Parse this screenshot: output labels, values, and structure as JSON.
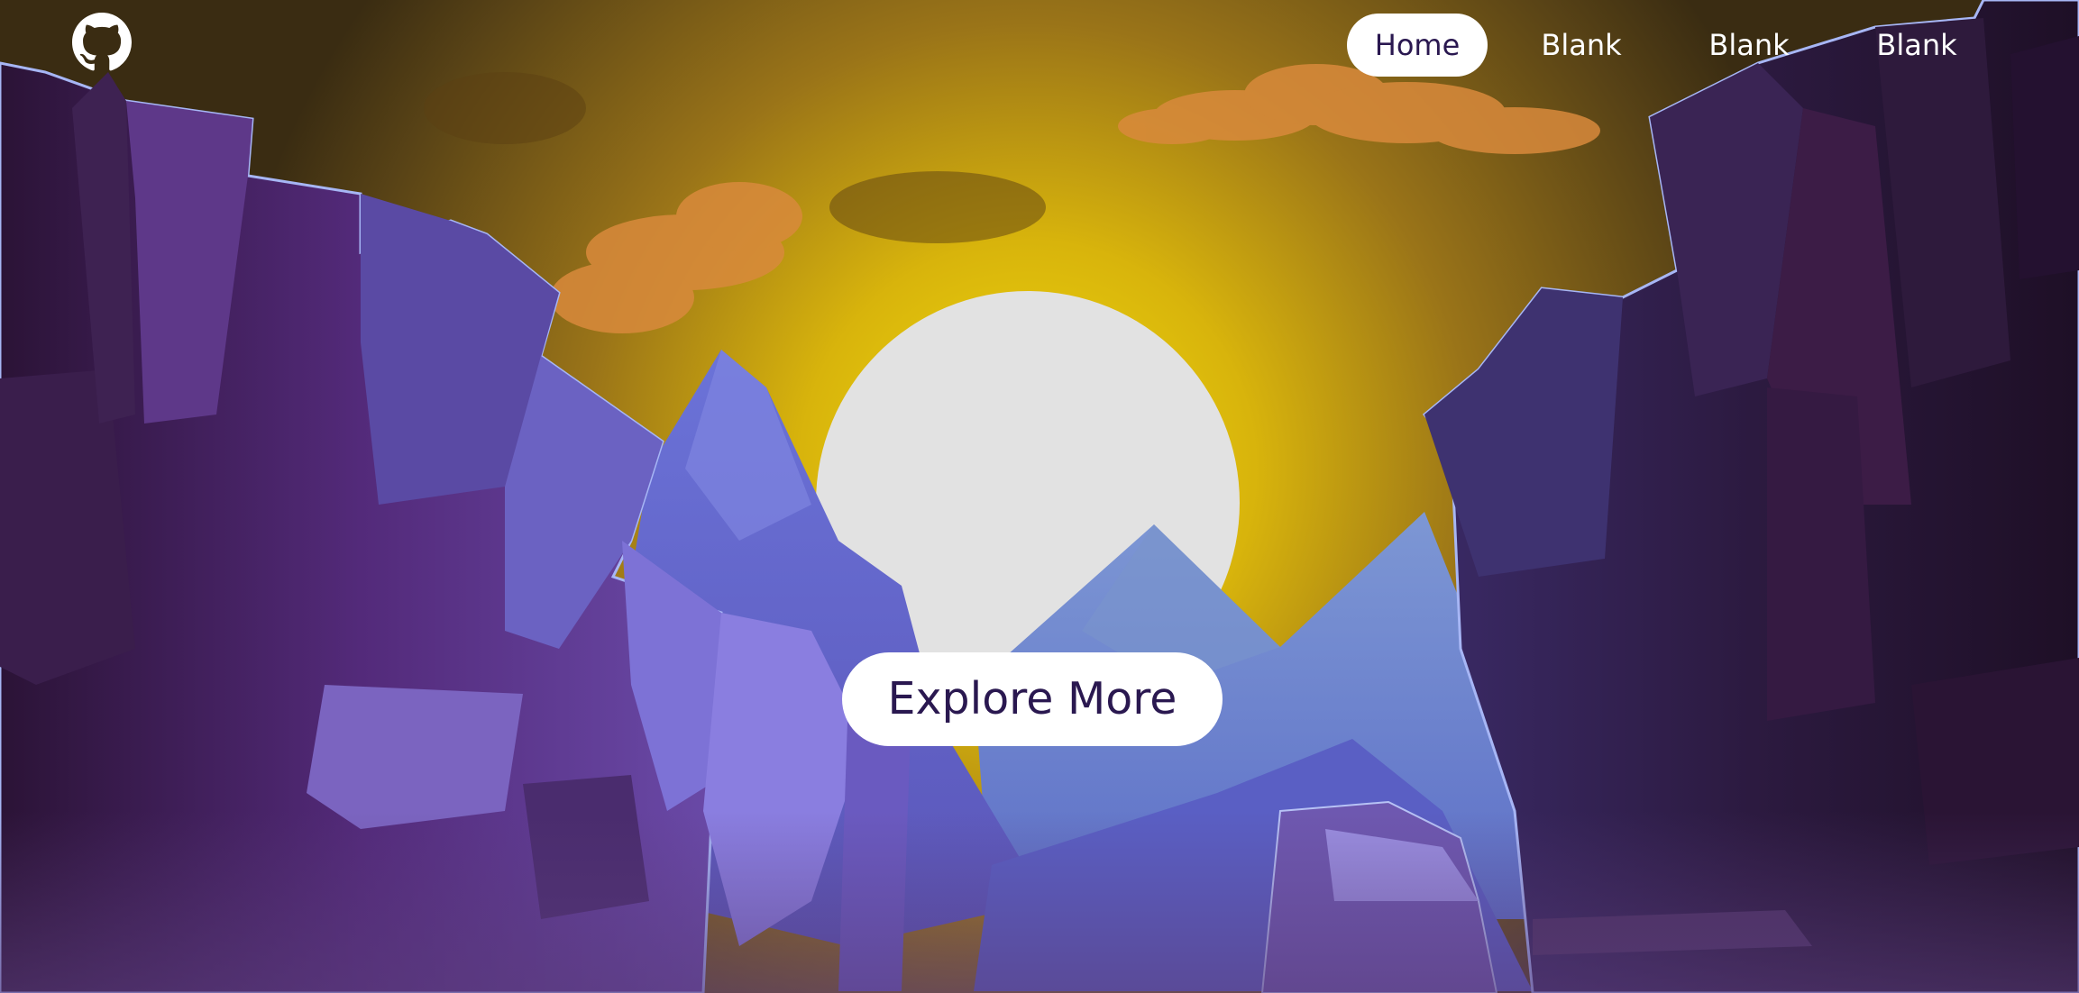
{
  "header": {
    "logo_icon": "github-icon"
  },
  "nav": {
    "items": [
      {
        "label": "Home",
        "active": true
      },
      {
        "label": "Blank",
        "active": false
      },
      {
        "label": "Blank",
        "active": false
      },
      {
        "label": "Blank",
        "active": false
      }
    ]
  },
  "hero": {
    "cta_label": "Explore More"
  },
  "colors": {
    "sky_top": "#3d2e10",
    "sky_glow": "#e3c40a",
    "sun": "#e2e2e2",
    "cliff_dark": "#2a1535",
    "cliff_mid": "#4a2a6e",
    "cliff_light": "#7b6ad0",
    "mountain_blue": "#6f85d0",
    "button_bg": "#ffffff",
    "button_text": "#2a1850"
  }
}
